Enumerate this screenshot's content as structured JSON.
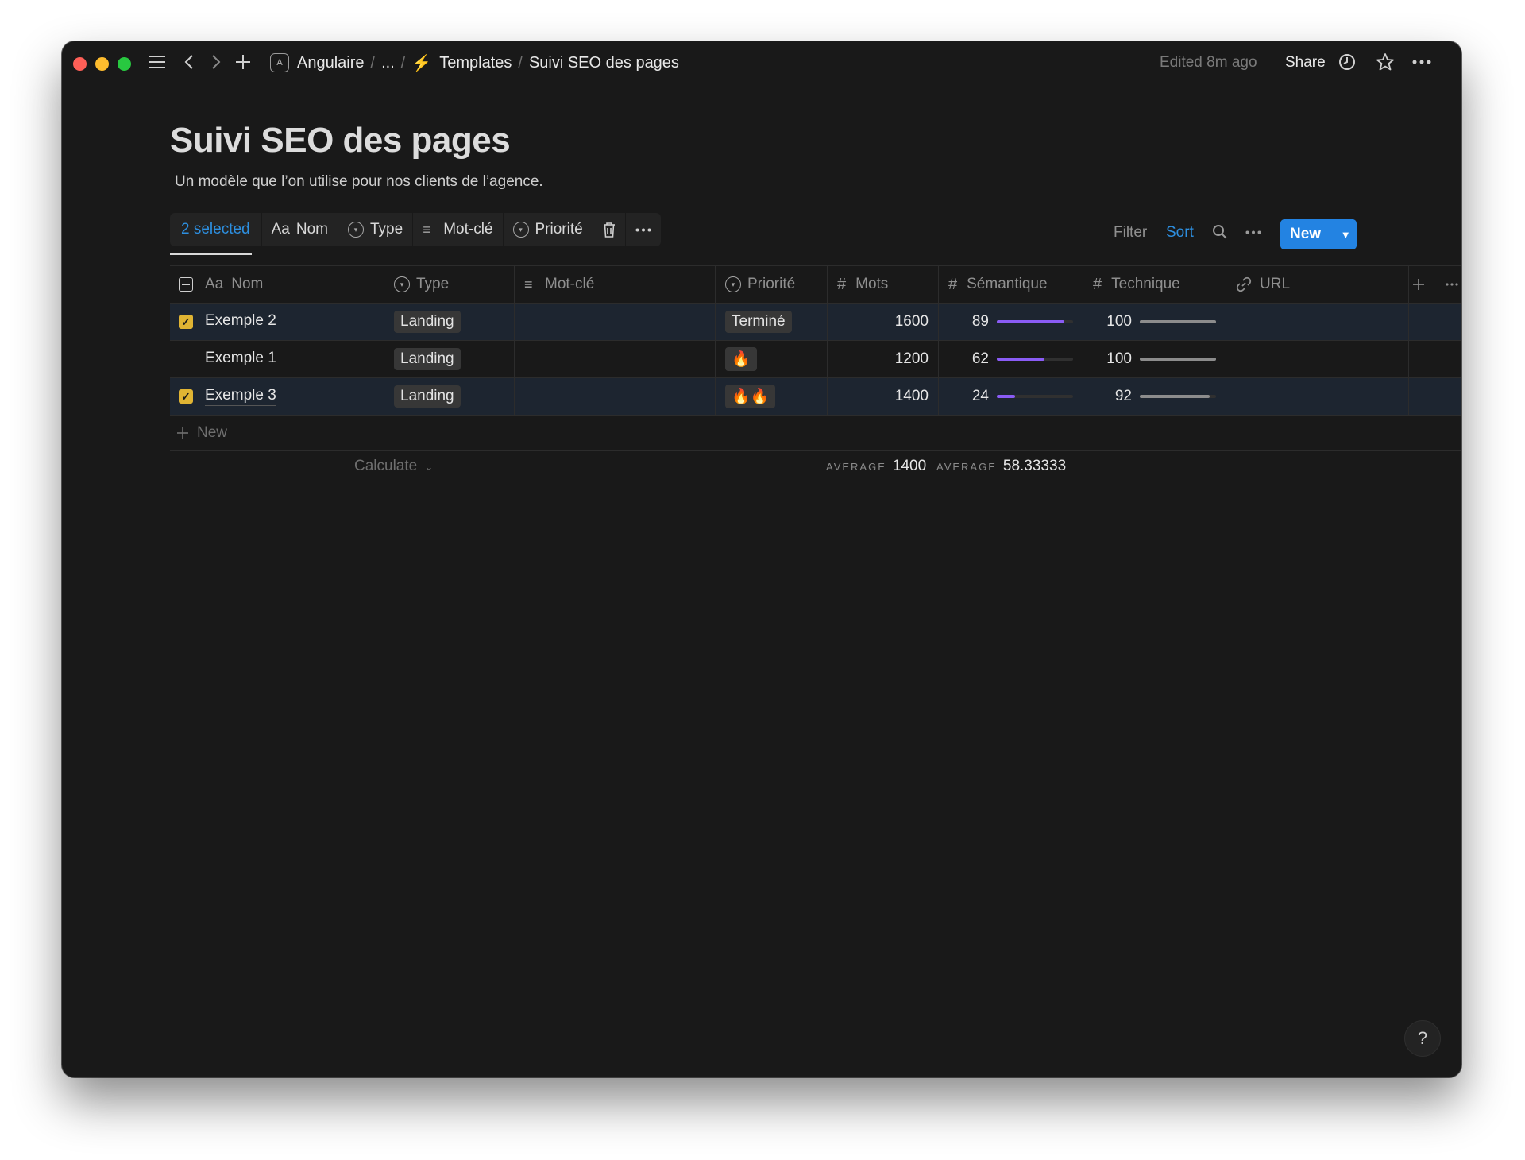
{
  "breadcrumb": {
    "workspace": "Angulaire",
    "ellipsis": "...",
    "section": "Templates",
    "page": "Suivi SEO des pages"
  },
  "topbar": {
    "edited": "Edited 8m ago",
    "share": "Share"
  },
  "page": {
    "title": "Suivi SEO des pages",
    "description": "Un modèle que l’on utilise pour nos clients de l’agence."
  },
  "selection_toolbar": {
    "selected": "2 selected",
    "nom": "Nom",
    "type": "Type",
    "motcle": "Mot-clé",
    "priorite": "Priorité"
  },
  "controls": {
    "filter": "Filter",
    "sort": "Sort",
    "new": "New"
  },
  "columns": {
    "nom": "Nom",
    "type": "Type",
    "motcle": "Mot-clé",
    "priorite": "Priorité",
    "mots": "Mots",
    "semantique": "Sémantique",
    "technique": "Technique",
    "url": "URL",
    "aa": "Aa"
  },
  "rows": [
    {
      "selected": true,
      "nom": "Exemple 2",
      "type": "Landing",
      "priorite": "Terminé",
      "mots": "1600",
      "semantique": "89",
      "semantique_frac": 0.89,
      "technique": "100",
      "technique_frac": 1.0
    },
    {
      "selected": false,
      "nom": "Exemple 1",
      "type": "Landing",
      "priorite": "🔥",
      "mots": "1200",
      "semantique": "62",
      "semantique_frac": 0.62,
      "technique": "100",
      "technique_frac": 1.0
    },
    {
      "selected": true,
      "nom": "Exemple 3",
      "type": "Landing",
      "priorite": "🔥🔥",
      "mots": "1400",
      "semantique": "24",
      "semantique_frac": 0.24,
      "technique": "92",
      "technique_frac": 0.92
    }
  ],
  "new_row": "New",
  "footer": {
    "calculate": "Calculate",
    "avg_label": "AVERAGE",
    "mots_avg": "1400",
    "semantique_avg": "58.33333"
  },
  "help": "?",
  "colors": {
    "accent": "#2383e2",
    "checkbox": "#e0b433",
    "semantic_bar": "#8a5cf5",
    "tech_bar": "#8c8c8c"
  }
}
